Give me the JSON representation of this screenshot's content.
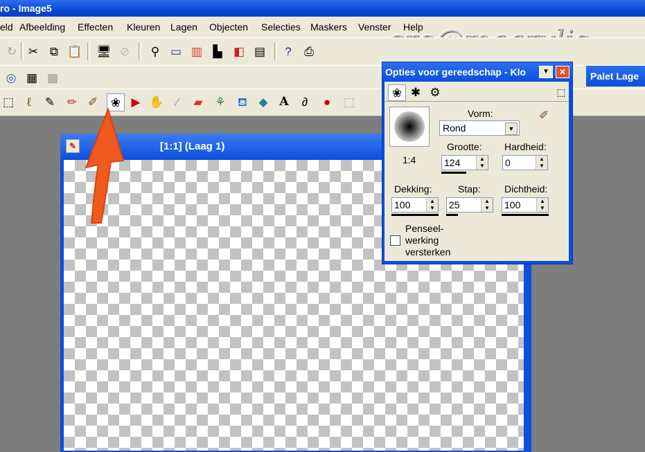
{
  "window": {
    "title": "ro - Image5"
  },
  "menu": [
    "eld",
    "Afbeelding",
    "Effecten",
    "Kleuren",
    "Lagen",
    "Objecten",
    "Selecties",
    "Maskers",
    "Venster",
    "Help"
  ],
  "watermark": "cre@maarylis",
  "image_window": {
    "title": "[1:1] (Laag 1)"
  },
  "palette_tab": "Palet Lage",
  "tool_options": {
    "title": "Opties voor gereedschap - Klo",
    "preview_ratio": "1:4",
    "vorm_label": "Vorm:",
    "vorm_value": "Rond",
    "grootte_label": "Grootte:",
    "grootte_value": "124",
    "hardheid_label": "Hardheid:",
    "hardheid_value": "0",
    "dekking_label": "Dekking:",
    "dekking_value": "100",
    "stap_label": "Stap:",
    "stap_value": "25",
    "dichtheid_label": "Dichtheid:",
    "dichtheid_value": "100",
    "penseel_line1": "Penseel-",
    "penseel_line2": "werking",
    "penseel_line3": "versterken"
  },
  "colors": {
    "title_blue": "#0b4fdc",
    "face": "#ece9d8",
    "arrow": "#f05a1e"
  },
  "icons": [
    "redo-icon",
    "cut-icon",
    "copy-icon",
    "paste-icon",
    "monitor-icon",
    "disabled-icon",
    "zoom-icon",
    "ruler-icon",
    "histogram-icon",
    "palette-icon",
    "layers-icon",
    "window-icon",
    "help-pointer-icon",
    "printer-icon",
    "globe-icon",
    "layers-tool-icon",
    "grid-icon",
    "selection-rect-icon",
    "lasso-icon",
    "pen-icon",
    "paintbrush-icon",
    "brush-icon",
    "clone-brush-icon",
    "replace-color-icon",
    "retouch-icon",
    "scratch-icon",
    "eraser-icon",
    "picture-tube-icon",
    "flood-fill-icon",
    "color-replacer-icon",
    "text-icon",
    "draw-icon",
    "preset-shapes-icon",
    "deform-icon"
  ]
}
